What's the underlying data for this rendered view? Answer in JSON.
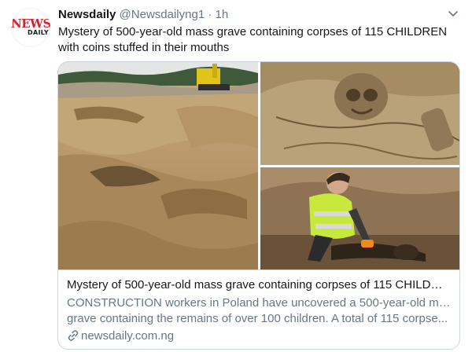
{
  "author": {
    "avatar_text_top": "NEWS",
    "avatar_text_bottom": "DAILY",
    "name": "Newsdaily",
    "handle": "@Newsdailyng1",
    "separator": "·",
    "time": "1h"
  },
  "tweet": {
    "text": "Mystery of 500-year-old mass grave containing corpses of 115 CHILDREN with coins stuffed in their mouths"
  },
  "card": {
    "images": [
      {
        "icon": "excavation-site-photo"
      },
      {
        "icon": "skull-in-soil-photo"
      },
      {
        "icon": "archaeologist-digging-photo"
      }
    ],
    "title": "Mystery of 500-year-old mass grave containing corpses of 115 CHILDRE...",
    "description_line1": "CONSTRUCTION workers in Poland have uncovered a 500-year-old mass",
    "description_line2": "grave containing the remains of over 100 children. A total of 115 corpse...",
    "domain": "newsdaily.com.ng",
    "link_icon": "link-icon"
  },
  "colors": {
    "brand_red": "#d6202c",
    "text_primary": "#14171a",
    "text_secondary": "#657786",
    "border": "#ccd6dd"
  }
}
